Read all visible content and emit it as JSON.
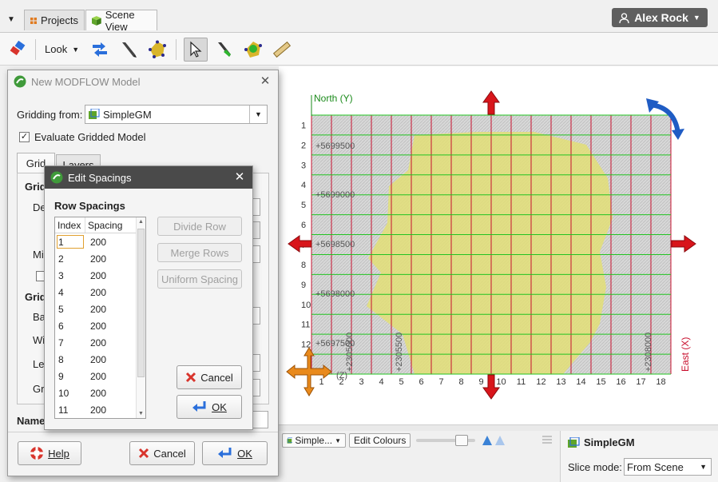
{
  "topbar": {
    "tabs": [
      {
        "label": "Projects",
        "icon": "grid-icon"
      },
      {
        "label": "Scene View",
        "icon": "cube-icon"
      }
    ],
    "user": "Alex Rock"
  },
  "toolbar": {
    "look_label": "Look"
  },
  "main_dialog": {
    "title": "New MODFLOW Model",
    "gridding_from_label": "Gridding from:",
    "gridding_from_value": "SimpleGM",
    "evaluate_label": "Evaluate Gridded Model",
    "evaluate_checked": true,
    "tabs": [
      "Grid",
      "Layers"
    ],
    "partial_labels": [
      "Grid",
      "De",
      "Mi",
      "Grid",
      "Ba",
      "Wi",
      "Le",
      "Gr",
      "Name"
    ],
    "help_label": "Help",
    "cancel_label": "Cancel",
    "ok_label": "OK"
  },
  "spacing_dialog": {
    "title": "Edit Spacings",
    "section_title": "Row Spacings",
    "columns": [
      "Index",
      "Spacing"
    ],
    "rows": [
      {
        "index": "1",
        "spacing": "200"
      },
      {
        "index": "2",
        "spacing": "200"
      },
      {
        "index": "3",
        "spacing": "200"
      },
      {
        "index": "4",
        "spacing": "200"
      },
      {
        "index": "5",
        "spacing": "200"
      },
      {
        "index": "6",
        "spacing": "200"
      },
      {
        "index": "7",
        "spacing": "200"
      },
      {
        "index": "8",
        "spacing": "200"
      },
      {
        "index": "9",
        "spacing": "200"
      },
      {
        "index": "10",
        "spacing": "200"
      },
      {
        "index": "11",
        "spacing": "200"
      }
    ],
    "divide_row_label": "Divide Row",
    "merge_rows_label": "Merge Rows",
    "uniform_spacing_label": "Uniform Spacing",
    "cancel_label": "Cancel",
    "ok_label": "OK"
  },
  "scene": {
    "north_label": "North (Y)",
    "east_label": "East (X)",
    "z_label": "(Z)",
    "row_labels": [
      "1",
      "2",
      "3",
      "4",
      "5",
      "6",
      "7",
      "8",
      "9",
      "10",
      "11",
      "12"
    ],
    "col_labels": [
      "1",
      "2",
      "3",
      "4",
      "5",
      "6",
      "7",
      "8",
      "9",
      "10",
      "11",
      "12",
      "13",
      "14",
      "15",
      "16",
      "17",
      "18"
    ],
    "y_ticks": [
      "+5699500",
      "+5699000",
      "+5698500",
      "+5698000",
      "+5697500"
    ],
    "x_ticks": [
      "+2305000",
      "+2305500",
      "+2308000"
    ],
    "colors": {
      "grid_red": "#c8102e",
      "grid_green": "#22c422",
      "model_fill": "#e3e070",
      "axis_green": "#1a8a1a"
    }
  },
  "scene_controls": {
    "object_value": "Simple...",
    "edit_colours_label": "Edit Colours"
  },
  "properties": {
    "title": "SimpleGM",
    "slice_mode_label": "Slice mode:",
    "slice_mode_value": "From Scene"
  }
}
